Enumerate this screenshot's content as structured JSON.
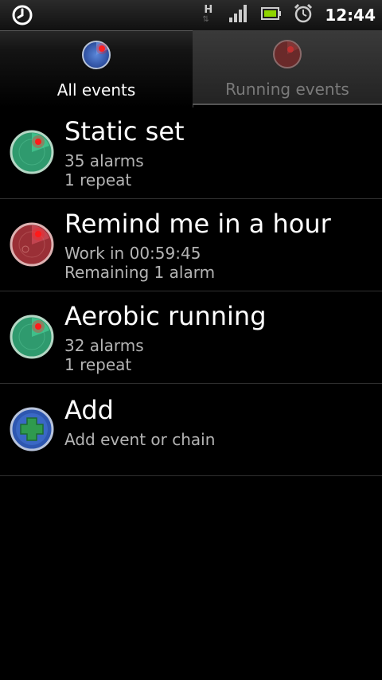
{
  "status_bar": {
    "time": "12:44",
    "network_type": "H",
    "icons": [
      "alarm-clock-app-icon",
      "network-h-icon",
      "signal-icon",
      "battery-icon",
      "alarm-icon"
    ]
  },
  "tabs": [
    {
      "label": "All events",
      "selected": true,
      "icon": "radar-blue-icon"
    },
    {
      "label": "Running events",
      "selected": false,
      "icon": "radar-red-icon"
    }
  ],
  "events": [
    {
      "title": "Static set",
      "line1": "35 alarms",
      "line2": "1 repeat",
      "icon": "radar-green-icon"
    },
    {
      "title": "Remind me in a hour",
      "line1": "Work in 00:59:45",
      "line2": "Remaining 1 alarm",
      "icon": "radar-red-icon"
    },
    {
      "title": "Aerobic running",
      "line1": "32 alarms",
      "line2": "1 repeat",
      "icon": "radar-green-icon"
    }
  ],
  "add_item": {
    "title": "Add",
    "subtitle": "Add event or chain",
    "icon": "add-plus-icon"
  },
  "colors": {
    "accent_green": "#3aa878",
    "accent_red": "#b23a3a",
    "accent_blue": "#2e57b0",
    "text_secondary": "#b4b4b4"
  }
}
